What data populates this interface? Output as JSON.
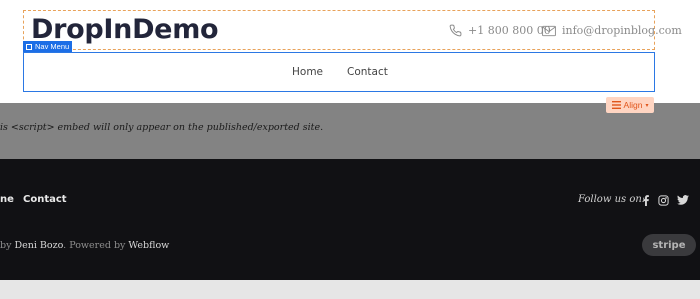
{
  "header": {
    "logo": "DropInDemo",
    "phone": "+1 800 800 00",
    "email": "info@dropinblog.com"
  },
  "editor": {
    "nav_tag": "Nav Menu",
    "align_label": "Align"
  },
  "nav": {
    "items": [
      "Home",
      "Contact"
    ]
  },
  "embed": {
    "notice": "is <script> embed will only appear on the published/exported site."
  },
  "footer": {
    "links": [
      "ne",
      "Contact"
    ],
    "follow": "Follow us on:",
    "credit_prefix": "by ",
    "credit_author": "Deni Bozo",
    "credit_middle": ". Powered by ",
    "credit_platform": "Webflow",
    "stripe_label": "stripe"
  },
  "icons": [
    "phone-icon",
    "mail-icon",
    "facebook-icon",
    "instagram-icon",
    "twitter-icon",
    "hamburger-icon"
  ],
  "colors": {
    "selection_blue": "#1c6ee6",
    "align_accent": "#e0561c",
    "footer_bg": "#111114"
  }
}
